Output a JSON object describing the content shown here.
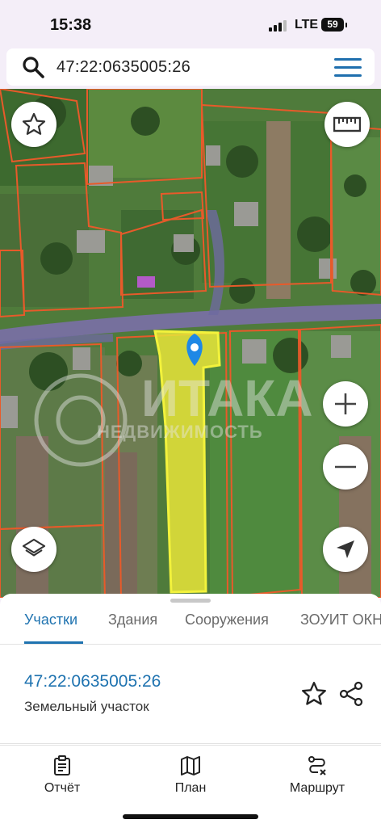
{
  "status_bar": {
    "time": "15:38",
    "network": "LTE",
    "battery": "59"
  },
  "search": {
    "query": "47:22:0635005:26"
  },
  "map": {
    "watermark": "ИТАКА",
    "watermark_sub": "НЕДВИЖИМОСТЬ",
    "colors": {
      "parcel_fill": "#e8e53a",
      "boundary": "#e85a2a",
      "road": "#7a6fa8",
      "pin": "#1e88e5"
    },
    "controls": [
      "star-icon",
      "ruler-icon",
      "layers-icon",
      "zoom-in-icon",
      "zoom-out-icon",
      "navigation-arrow-icon"
    ]
  },
  "tabs": [
    {
      "label": "Участки",
      "active": true
    },
    {
      "label": "Здания",
      "active": false
    },
    {
      "label": "Сооружения",
      "active": false
    },
    {
      "label": "ЗОУИТ ОКН",
      "active": false
    }
  ],
  "parcel": {
    "id": "47:22:0635005:26",
    "type": "Земельный участок"
  },
  "bottom_nav": [
    {
      "label": "Отчёт",
      "icon": "report-clipboard-icon"
    },
    {
      "label": "План",
      "icon": "map-plan-icon"
    },
    {
      "label": "Маршрут",
      "icon": "route-icon"
    }
  ],
  "accent_color": "#1f73b0"
}
